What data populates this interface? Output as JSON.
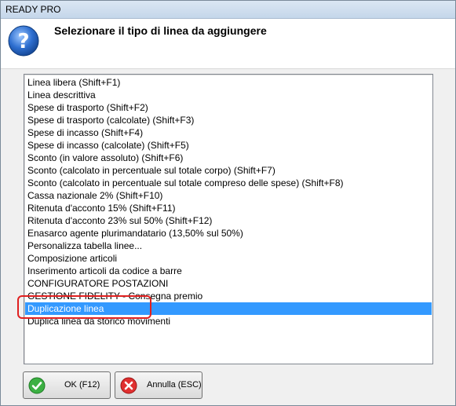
{
  "window": {
    "title": "READY PRO"
  },
  "dialog": {
    "prompt": "Selezionare il tipo di linea da aggiungere",
    "icon": "help-question-icon"
  },
  "list": {
    "selected_index": 18,
    "items": [
      "Linea libera (Shift+F1)",
      "Linea descrittiva",
      "Spese di trasporto (Shift+F2)",
      "Spese di trasporto (calcolate) (Shift+F3)",
      "Spese di incasso (Shift+F4)",
      "Spese di incasso (calcolate) (Shift+F5)",
      "Sconto (in valore assoluto) (Shift+F6)",
      "Sconto (calcolato in percentuale sul totale corpo) (Shift+F7)",
      "Sconto (calcolato in percentuale sul totale compreso delle spese) (Shift+F8)",
      "Cassa nazionale 2% (Shift+F10)",
      "Ritenuta d'acconto 15% (Shift+F11)",
      "Ritenuta d'acconto 23% sul 50% (Shift+F12)",
      "Enasarco agente plurimandatario (13,50% sul 50%)",
      "Personalizza tabella linee...",
      "Composizione articoli",
      "Inserimento articoli da codice a barre",
      "CONFIGURATORE POSTAZIONI",
      "GESTIONE FIDELITY - Consegna premio",
      "Duplicazione linea",
      "Duplica linea da storico movimenti"
    ]
  },
  "buttons": {
    "ok": {
      "label": "OK (F12)",
      "icon": "check-icon",
      "color": "#2a9d2a"
    },
    "cancel": {
      "label": "Annulla (ESC)",
      "icon": "close-icon",
      "color": "#d42a2a"
    }
  },
  "colors": {
    "selection": "#3399ff",
    "highlight_ring": "#e02020"
  }
}
